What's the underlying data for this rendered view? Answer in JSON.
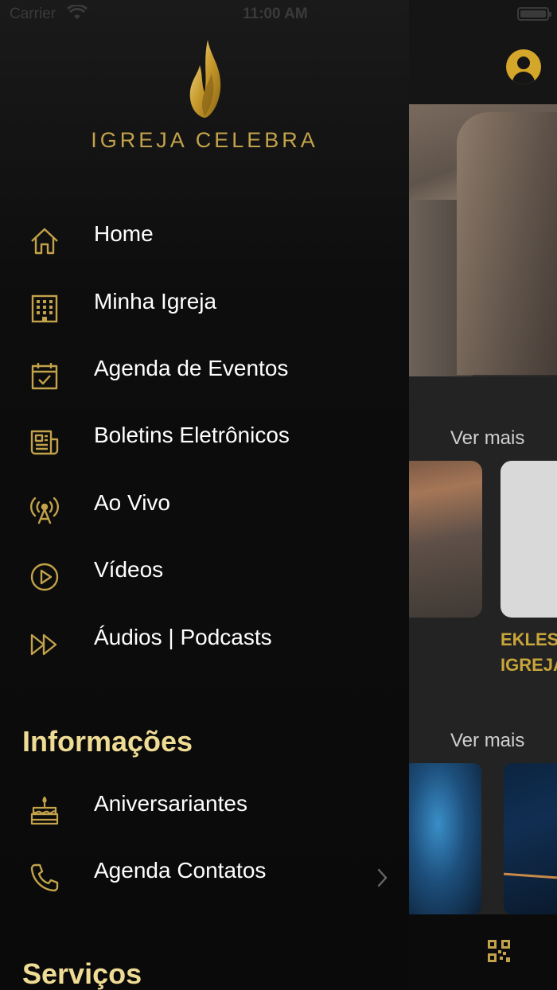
{
  "status_bar": {
    "carrier": "Carrier",
    "time": "11:00 AM"
  },
  "brand": {
    "name": "IGREJA CELEBRA",
    "accent_color": "#c2a24a"
  },
  "menu": [
    {
      "label": "Home",
      "icon": "home-icon"
    },
    {
      "label": "Minha Igreja",
      "icon": "building-icon"
    },
    {
      "label": "Agenda de Eventos",
      "icon": "calendar-check-icon"
    },
    {
      "label": "Boletins Eletrônicos",
      "icon": "newspaper-icon"
    },
    {
      "label": "Ao Vivo",
      "icon": "broadcast-icon"
    },
    {
      "label": "Vídeos",
      "icon": "play-circle-icon"
    },
    {
      "label": "Áudios | Podcasts",
      "icon": "fast-forward-icon"
    }
  ],
  "sections": {
    "informacoes": {
      "title": "Informações",
      "items": [
        {
          "label": "Aniversariantes",
          "icon": "cake-icon"
        },
        {
          "label": "Agenda Contatos",
          "icon": "phone-icon",
          "has_submenu": true
        }
      ]
    },
    "servicos": {
      "title": "Serviços"
    }
  },
  "background": {
    "ver_mais_1": "Ver mais",
    "ver_mais_2": "Ver mais",
    "card_caption_line1": "EKLESI",
    "card_caption_line2": "IGREJA"
  },
  "colors": {
    "icon_gold": "#c2a24a",
    "section_title": "#efdc94"
  }
}
